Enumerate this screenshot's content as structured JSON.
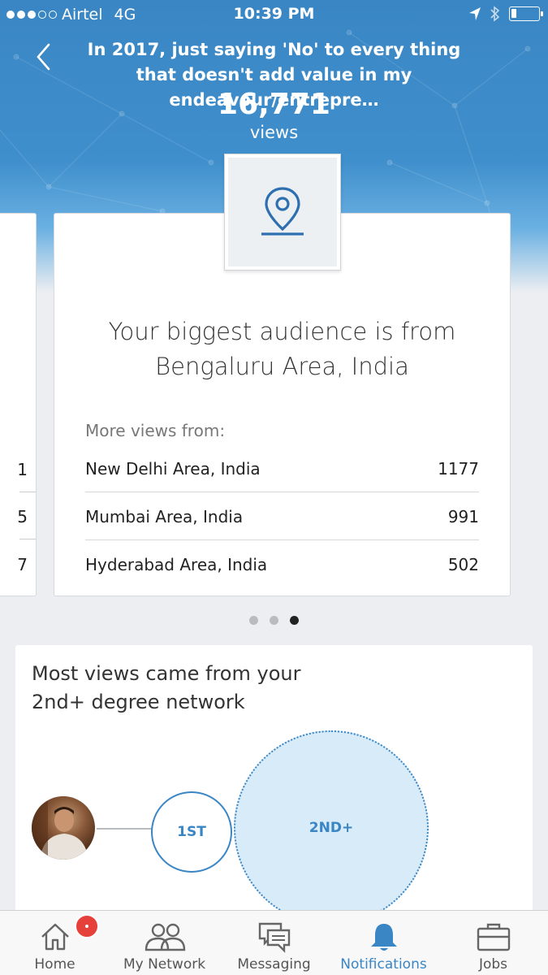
{
  "status_bar": {
    "carrier": "Airtel",
    "network": "4G",
    "time": "10:39 PM",
    "signal_bars_filled": 3,
    "signal_bars_total": 5,
    "battery_level": 0.2
  },
  "header": {
    "post_title": "In 2017, just saying 'No' to every thing that doesn't add value in my endeavour/entrepre…",
    "views_count": "16,771",
    "views_label": "views"
  },
  "audience_card": {
    "icon": "location-pin-icon",
    "title_line1": "Your biggest audience is from",
    "title_line2": "Bengaluru Area, India",
    "more_views_label": "More views from:",
    "locations": [
      {
        "name": "New Delhi Area, India",
        "count": "1177"
      },
      {
        "name": "Mumbai Area, India",
        "count": "991"
      },
      {
        "name": "Hyderabad Area, India",
        "count": "502"
      }
    ]
  },
  "side_card": {
    "numbers": [
      "1",
      "5",
      "7"
    ]
  },
  "pager": {
    "total": 3,
    "active_index": 2
  },
  "network_card": {
    "title": "Most views came from your 2nd+ degree network",
    "first_label": "1ST",
    "second_label": "2ND+"
  },
  "tab_bar": {
    "tabs": [
      {
        "label": "Home",
        "icon": "home-icon"
      },
      {
        "label": "My Network",
        "icon": "network-icon"
      },
      {
        "label": "Messaging",
        "icon": "messaging-icon"
      },
      {
        "label": "Notifications",
        "icon": "bell-icon"
      },
      {
        "label": "Jobs",
        "icon": "briefcase-icon"
      }
    ],
    "active_tab": "Notifications"
  },
  "colors": {
    "accent": "#3a86c4",
    "badge": "#e5413a",
    "second_degree_fill": "#d8ebf8"
  }
}
